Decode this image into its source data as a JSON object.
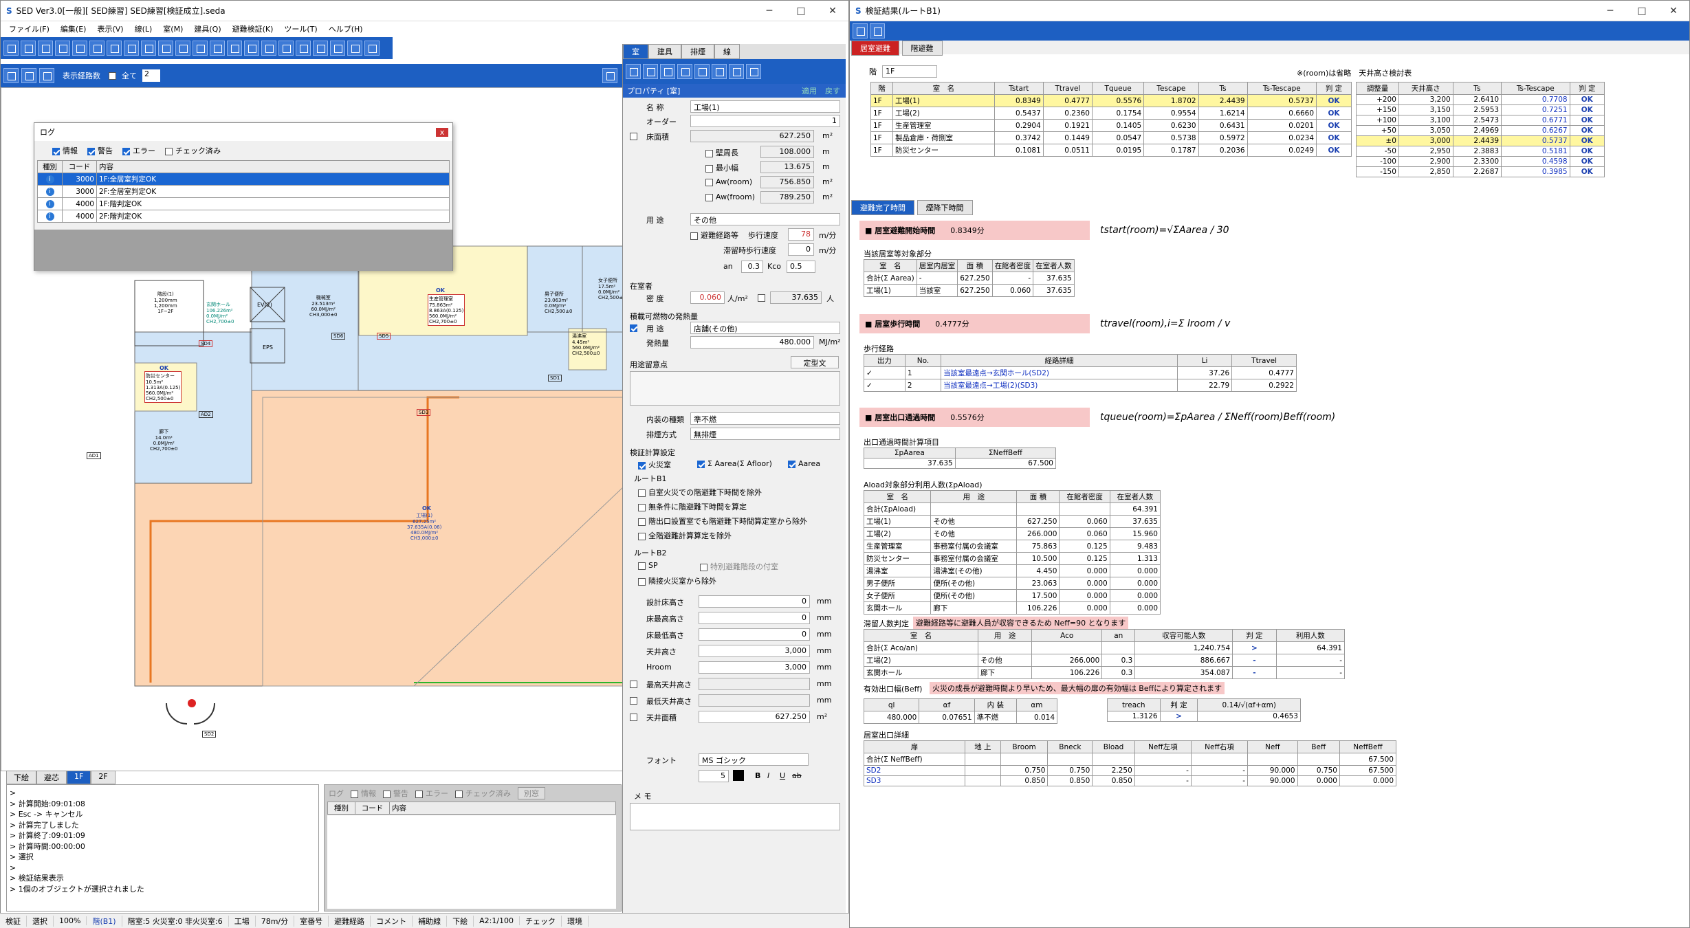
{
  "left_window": {
    "title": "SED Ver3.0[一般][ SED練習] SED練習[検証成立].seda",
    "menu": [
      "ファイル(F)",
      "編集(E)",
      "表示(V)",
      "線(L)",
      "室(M)",
      "建具(Q)",
      "避難検証(K)",
      "ツール(T)",
      "ヘルプ(H)"
    ],
    "route_label": "表示経路数",
    "all_label": "全て",
    "route_value": "2",
    "log": {
      "title": "ログ",
      "close": "x",
      "filters": [
        "情報",
        "警告",
        "エラー",
        "チェック済み"
      ],
      "headers": [
        "種別",
        "コード",
        "内容"
      ],
      "rows": [
        [
          "3000",
          "1F:全居室判定OK"
        ],
        [
          "3000",
          "2F:全居室判定OK"
        ],
        [
          "4000",
          "1F:階判定OK"
        ],
        [
          "4000",
          "2F:階判定OK"
        ]
      ]
    },
    "plan_labels": {
      "stair": "階段(1)\n1,200mm\n1,200mm\n1F~2F",
      "hall": "玄関ホール\n106.226m²\n0.0MJ/m²\nCH2,700±0",
      "mech": "機械室\n23.513m²\n60.0MJ/m²\nCH3,000±0",
      "prodmgmt_ok": "OK",
      "prodmgmt": "生産管理室\n75.863m²\n8.863A(0.125)\n560.0MJ/m²\nCH2,700±0",
      "wc_m": "男子便所\n23.063m²\n0.0MJ/m²\nCH2,500±0",
      "wc_f": "女子便所\n17.5m²\n0.0MJ/m²\nCH2,500±0",
      "eps": "EPS",
      "ev": "EV(2)",
      "disaster_ok": "OK",
      "disaster": "防災センター\n10.5m²\n1.313A(0.125)\n560.0MJ/m²\nCH2,500±0",
      "wash": "湯沸室\n4.45m²\n560.0MJ/m²\nCH2,500±0",
      "corridor": "廊下\n14.0m²\n0.0MJ/m²\nCH2,700±0",
      "factory_ok": "OK",
      "factory": "工場(1)\n627.25m²\n37.635A(0.06)\n480.0MJ/m²\nCH3,000±0",
      "sd4": "SD4",
      "sd6": "SD6",
      "sd5": "SD5",
      "sd1": "SD1",
      "ad1": "AD1",
      "ad2": "AD2",
      "sd3": "SD3",
      "sd2": "SD2"
    },
    "floor_tabs": [
      "下絵",
      "避芯",
      "1F",
      "2F"
    ],
    "console": [
      "> ",
      "> 計算開始:09:01:08",
      "> Esc -> キャンセル",
      "> 計算完了しました",
      "> 計算終了:09:01:09",
      "> 計算時間:00:00:00",
      "> 選択",
      "> ",
      "> 検証結果表示",
      "> 1個のオブジェクトが選択されました"
    ],
    "console_log": {
      "filters": [
        "ログ",
        "情報",
        "警告",
        "エラー",
        "チェック済み"
      ],
      "btn": "別窓",
      "headers": [
        "種別",
        "コード",
        "内容"
      ]
    },
    "status": [
      "検証",
      "選択",
      "100%",
      "階(B1)",
      "階室:5 火災室:0 非火災室:6",
      "工場",
      "78m/分",
      "室番号",
      "避難経路",
      "コメント",
      "補助線",
      "下絵",
      "A2:1/100",
      "チェック",
      "環境"
    ]
  },
  "property": {
    "tabs": [
      "室",
      "建具",
      "排煙",
      "線"
    ],
    "title": "プロパティ [室]",
    "apply": "適用",
    "cancel": "戻す",
    "name_label": "名 称",
    "name": "工場(1)",
    "order_label": "オーダー",
    "order": "1",
    "area_label": "床面積",
    "area": "627.250",
    "area_unit": "m²",
    "wall_label": "壁周長",
    "wall": "108.000",
    "wall_unit": "m",
    "min_label": "最小幅",
    "min": "13.675",
    "min_unit": "m",
    "aw_label": "Aw(room)",
    "aw": "756.850",
    "aw_unit": "m²",
    "af_label": "Aw(froom)",
    "af": "789.250",
    "af_unit": "m²",
    "use_label": "用 途",
    "use": "その他",
    "evac_label": "避難経路等",
    "walk_label": "歩行速度",
    "walk": "78",
    "walk_unit": "m/分",
    "stay_label": "滞留時歩行速度",
    "stay": "0",
    "stay_unit": "m/分",
    "an_label": "an",
    "an": "0.3",
    "kco_label": "Kco",
    "kco": "0.5",
    "occ_label": "在室者",
    "density_label": "密 度",
    "density": "0.060",
    "density_unit": "人/m²",
    "persons": "37.635",
    "persons_unit": "人",
    "fire_label": "積載可燃物の発熱量",
    "use2_label": "用 途",
    "use2": "店舗(その他)",
    "heat_label": "発熱量",
    "heat": "480.000",
    "heat_unit": "MJ/m²",
    "note_label": "用途留意点",
    "note_btn": "定型文",
    "finish_label": "内装の種類",
    "finish": "準不燃",
    "smoke_label": "排煙方式",
    "smoke": "無排煙",
    "calc_label": "検証計算設定",
    "fire_room": "火災室",
    "aarea_sum": "Σ Aarea(Σ Afloor)",
    "aarea": "Aarea",
    "route_b1": "ルートB1",
    "b1_opts": [
      "自室火災での階避難下時間を除外",
      "無条件に階避難下時間を算定",
      "階出口設置室でも階避難下時間算定室から除外",
      "全階避難計算算定を除外"
    ],
    "route_b2": "ルートB2",
    "sp": "SP",
    "special": "特別避難階段の付室",
    "exclude": "隣接火災室から除外",
    "heights": [
      [
        "設計床高さ",
        "0",
        "mm"
      ],
      [
        "床最高高さ",
        "0",
        "mm"
      ],
      [
        "床最低高さ",
        "0",
        "mm"
      ],
      [
        "天井高さ",
        "3,000",
        "mm"
      ],
      [
        "Hroom",
        "3,000",
        "mm"
      ],
      [
        "最高天井高さ",
        "",
        "mm"
      ],
      [
        "最低天井高さ",
        "",
        "mm"
      ],
      [
        "天井面積",
        "627.250",
        "m²"
      ]
    ],
    "font_label": "フォント",
    "font": "MS ゴシック",
    "font_size": "5",
    "b": "B",
    "i": "I",
    "u": "U",
    "s": "ab",
    "memo_label": "メ モ"
  },
  "right_window": {
    "title": "検証結果(ルートB1)",
    "tabs": [
      "居室避難",
      "階避難"
    ],
    "floor_label": "階",
    "floor": "1F",
    "note": "※(room)は省略　天井高さ検討表",
    "room_headers": [
      "階",
      "室　名",
      "Tstart",
      "Ttravel",
      "Tqueue",
      "Tescape",
      "Ts",
      "Ts-Tescape",
      "判 定"
    ],
    "rooms": [
      [
        "1F",
        "工場(1)",
        "0.8349",
        "0.4777",
        "0.5576",
        "1.8702",
        "2.4439",
        "0.5737",
        "OK"
      ],
      [
        "1F",
        "工場(2)",
        "0.5437",
        "0.2360",
        "0.1754",
        "0.9554",
        "1.6214",
        "0.6660",
        "OK"
      ],
      [
        "1F",
        "生産管理室",
        "0.2904",
        "0.1921",
        "0.1405",
        "0.6230",
        "0.6431",
        "0.0201",
        "OK"
      ],
      [
        "1F",
        "製品倉庫・荷捌室",
        "0.3742",
        "0.1449",
        "0.0547",
        "0.5738",
        "0.5972",
        "0.0234",
        "OK"
      ],
      [
        "1F",
        "防災センター",
        "0.1081",
        "0.0511",
        "0.0195",
        "0.1787",
        "0.2036",
        "0.0249",
        "OK"
      ]
    ],
    "ceil_headers": [
      "調整量",
      "天井高さ",
      "Ts",
      "Ts-Tescape",
      "判 定"
    ],
    "ceil": [
      [
        "+200",
        "3,200",
        "2.6410",
        "0.7708",
        "OK"
      ],
      [
        "+150",
        "3,150",
        "2.5953",
        "0.7251",
        "OK"
      ],
      [
        "+100",
        "3,100",
        "2.5473",
        "0.6771",
        "OK"
      ],
      [
        "+50",
        "3,050",
        "2.4969",
        "0.6267",
        "OK"
      ],
      [
        "±0",
        "3,000",
        "2.4439",
        "0.5737",
        "OK"
      ],
      [
        "-50",
        "2,950",
        "2.3883",
        "0.5181",
        "OK"
      ],
      [
        "-100",
        "2,900",
        "2.3300",
        "0.4598",
        "OK"
      ],
      [
        "-150",
        "2,850",
        "2.2687",
        "0.3985",
        "OK"
      ]
    ],
    "sub_tabs": [
      "避難完了時間",
      "煙降下時間"
    ],
    "s1_title": "■ 居室避難開始時間",
    "s1_val": "0.8349分",
    "s1_formula": "tstart(room)=√ΣAarea / 30",
    "s1_sub": "当該居室等対象部分",
    "s1_headers": [
      "室　名",
      "居室内居室",
      "面 積",
      "在館者密度",
      "在室者人数"
    ],
    "s1_rows": [
      [
        "合計(Σ Aarea)",
        "-",
        "627.250",
        "-",
        "37.635"
      ],
      [
        "工場(1)",
        "当該室",
        "627.250",
        "0.060",
        "37.635"
      ]
    ],
    "s2_title": "■ 居室歩行時間",
    "s2_val": "0.4777分",
    "s2_formula": "ttravel(room),i=Σ lroom / v",
    "s2_sub": "歩行経路",
    "s2_headers": [
      "出力",
      "No.",
      "経路詳細",
      "Li",
      "Ttravel"
    ],
    "s2_rows": [
      [
        "✓",
        "1",
        "当該室最遠点→玄関ホール(SD2)",
        "37.26",
        "0.4777"
      ],
      [
        "✓",
        "2",
        "当該室最遠点→工場(2)(SD3)",
        "22.79",
        "0.2922"
      ]
    ],
    "s3_title": "■ 居室出口通過時間",
    "s3_val": "0.5576分",
    "s3_formula": "tqueue(room)=ΣpAarea / ΣNeff(room)Beff(room)",
    "s3_sub": "出口通過時間計算項目",
    "s3_headers": [
      "ΣpAarea",
      "ΣNeffBeff"
    ],
    "s3_row": [
      "37.635",
      "67.500"
    ],
    "s4_sub": "Aload対象部分利用人数(ΣpAload)",
    "s4_headers": [
      "室　名",
      "用　途",
      "面 積",
      "在館者密度",
      "在室者人数"
    ],
    "s4_rows": [
      [
        "合計(ΣpAload)",
        "",
        "",
        "",
        "64.391"
      ],
      [
        "工場(1)",
        "その他",
        "627.250",
        "0.060",
        "37.635"
      ],
      [
        "工場(2)",
        "その他",
        "266.000",
        "0.060",
        "15.960"
      ],
      [
        "生産管理室",
        "事務室付属の会議室",
        "75.863",
        "0.125",
        "9.483"
      ],
      [
        "防災センター",
        "事務室付属の会議室",
        "10.500",
        "0.125",
        "1.313"
      ],
      [
        "湯沸室",
        "湯沸室(その他)",
        "4.450",
        "0.000",
        "0.000"
      ],
      [
        "男子便所",
        "便所(その他)",
        "23.063",
        "0.000",
        "0.000"
      ],
      [
        "女子便所",
        "便所(その他)",
        "17.500",
        "0.000",
        "0.000"
      ],
      [
        "玄関ホール",
        "廊下",
        "106.226",
        "0.000",
        "0.000"
      ]
    ],
    "s5_label": "滞留人数判定",
    "s5_note": "避難経路等に避難人員が収容できるため Neff=90 となります",
    "s5_headers": [
      "室　名",
      "用　途",
      "Aco",
      "an",
      "収容可能人数",
      "判 定",
      "利用人数"
    ],
    "s5_rows": [
      [
        "合計(Σ Aco/an)",
        "",
        "",
        "",
        "1,240.754",
        ">",
        "64.391"
      ],
      [
        "工場(2)",
        "その他",
        "266.000",
        "0.3",
        "886.667",
        "-",
        "-"
      ],
      [
        "玄関ホール",
        "廊下",
        "106.226",
        "0.3",
        "354.087",
        "-",
        "-"
      ]
    ],
    "s6_label": "有効出口幅(Beff)",
    "s6_note": "火災の成長が避難時間より早いため、最大幅の扉の有効幅は Beffにより算定されます",
    "s6_headers": [
      "ql",
      "αf",
      "内 装",
      "αm"
    ],
    "s6_row": [
      "480.000",
      "0.07651",
      "準不燃",
      "0.014"
    ],
    "s6b_headers": [
      "treach",
      "判 定",
      "0.14/√(αf+αm)"
    ],
    "s6b_row": [
      "1.3126",
      ">",
      "0.4653"
    ],
    "s7_sub": "居室出口詳細",
    "s7_headers": [
      "扉",
      "地 上",
      "Broom",
      "Bneck",
      "Bload",
      "Neff左項",
      "Neff右項",
      "Neff",
      "Beff",
      "NeffBeff"
    ],
    "s7_rows": [
      [
        "合計(Σ NeffBeff)",
        "",
        "",
        "",
        "",
        "",
        "",
        "",
        "",
        "67.500"
      ],
      [
        "SD2",
        "",
        "0.750",
        "0.750",
        "2.250",
        "-",
        "-",
        "90.000",
        "0.750",
        "67.500"
      ],
      [
        "SD3",
        "",
        "0.850",
        "0.850",
        "0.850",
        "-",
        "-",
        "90.000",
        "0.000",
        "0.000"
      ]
    ]
  },
  "colors": {
    "accent": "#1d5fc2",
    "factory": "#fcd5b4",
    "corridor": "#d0e4f7",
    "room": "#fdf7c9",
    "ok": "#1a3fb0",
    "pink": "#f7c8c8",
    "highlight": "#fff7a0"
  }
}
